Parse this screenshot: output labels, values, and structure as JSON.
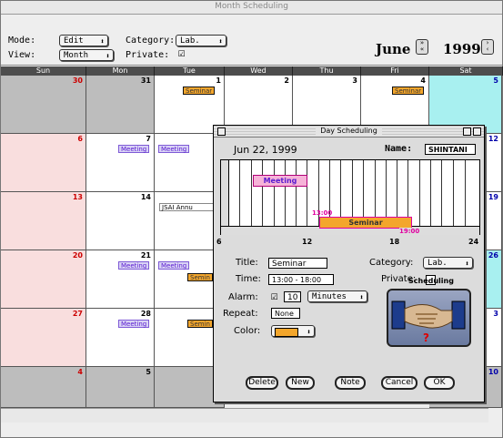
{
  "window": {
    "title": "Month Scheduling"
  },
  "toolbar": {
    "mode_label": "Mode:",
    "mode_value": "Edit",
    "category_label": "Category:",
    "category_value": "Lab.",
    "view_label": "View:",
    "view_value": "Month",
    "private_label": "Private:",
    "private_checked": "☑",
    "month": "June",
    "year": "1999"
  },
  "calendar": {
    "weekdays": [
      "Sun",
      "Mon",
      "Tue",
      "Wed",
      "Thu",
      "Fri",
      "Sat"
    ],
    "day_numbers": [
      "30",
      "31",
      "1",
      "2",
      "3",
      "4",
      "5",
      "6",
      "7",
      "12",
      "13",
      "14",
      "19",
      "20",
      "21",
      "26",
      "27",
      "28",
      "3",
      "4",
      "5",
      "10"
    ],
    "events": {
      "seminar": "Seminar",
      "meeting": "Meeting",
      "jsai": "JSAI Annu",
      "semin": "Semin"
    }
  },
  "dialog": {
    "title": "Day Scheduling",
    "date": "Jun 22, 1999",
    "name_label": "Name:",
    "name_value": "SHINTANI",
    "timeline": {
      "meeting": "Meeting",
      "seminar": "Seminar",
      "start": "13:00",
      "end": "19:00",
      "ticks": [
        "6",
        "12",
        "18",
        "24"
      ]
    },
    "title_label": "Title:",
    "title_value": "Seminar",
    "category_label": "Category:",
    "category_value": "Lab.",
    "time_label": "Time:",
    "time_value": "13:00 - 18:00",
    "private_label": "Private:",
    "alarm_label": "Alarm:",
    "alarm_checked": "☑",
    "alarm_value": "10",
    "alarm_unit": "Minutes",
    "repeat_label": "Repeat:",
    "repeat_value": "None",
    "color_label": "Color:",
    "color_hex": "#f3a62c",
    "scheduling_label": "Scheduling",
    "buttons": {
      "delete": "Delete",
      "new": "New",
      "note": "Note",
      "cancel": "Cancel",
      "ok": "OK"
    }
  }
}
